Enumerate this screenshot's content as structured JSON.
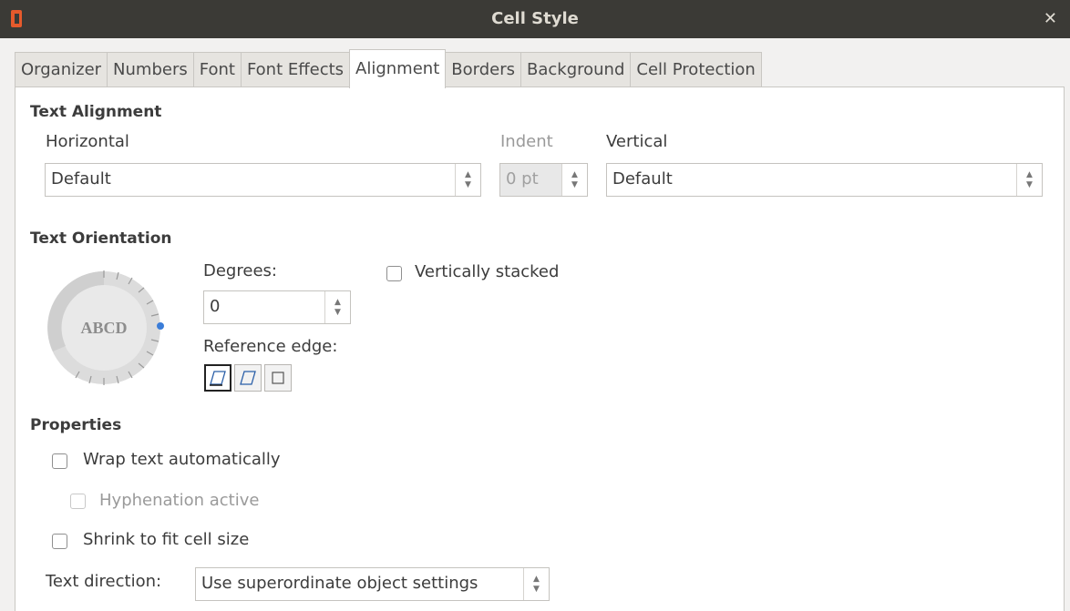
{
  "window": {
    "title": "Cell Style"
  },
  "tabs": [
    {
      "label": "Organizer"
    },
    {
      "label": "Numbers"
    },
    {
      "label": "Font"
    },
    {
      "label": "Font Effects"
    },
    {
      "label": "Alignment",
      "active": true
    },
    {
      "label": "Borders"
    },
    {
      "label": "Background"
    },
    {
      "label": "Cell Protection"
    }
  ],
  "text_alignment": {
    "section_label": "Text Alignment",
    "horizontal_label": "Horizontal",
    "horizontal_value": "Default",
    "indent_label": "Indent",
    "indent_value": "0 pt",
    "vertical_label": "Vertical",
    "vertical_value": "Default"
  },
  "text_orientation": {
    "section_label": "Text Orientation",
    "dial_text": "ABCD",
    "degrees_label": "Degrees:",
    "degrees_value": "0",
    "reference_edge_label": "Reference edge:",
    "vertically_stacked_label": "Vertically stacked",
    "vertically_stacked_checked": false
  },
  "properties": {
    "section_label": "Properties",
    "wrap_label": "Wrap text automatically",
    "hyphenation_label": "Hyphenation active",
    "shrink_label": "Shrink to fit cell size",
    "text_direction_label": "Text direction:",
    "text_direction_value": "Use superordinate object settings"
  },
  "colors": {
    "titlebar": "#3b3a36",
    "dial_accent": "#3b7dd8"
  },
  "icons": {
    "app": "libreoffice-icon",
    "close": "close-icon"
  }
}
